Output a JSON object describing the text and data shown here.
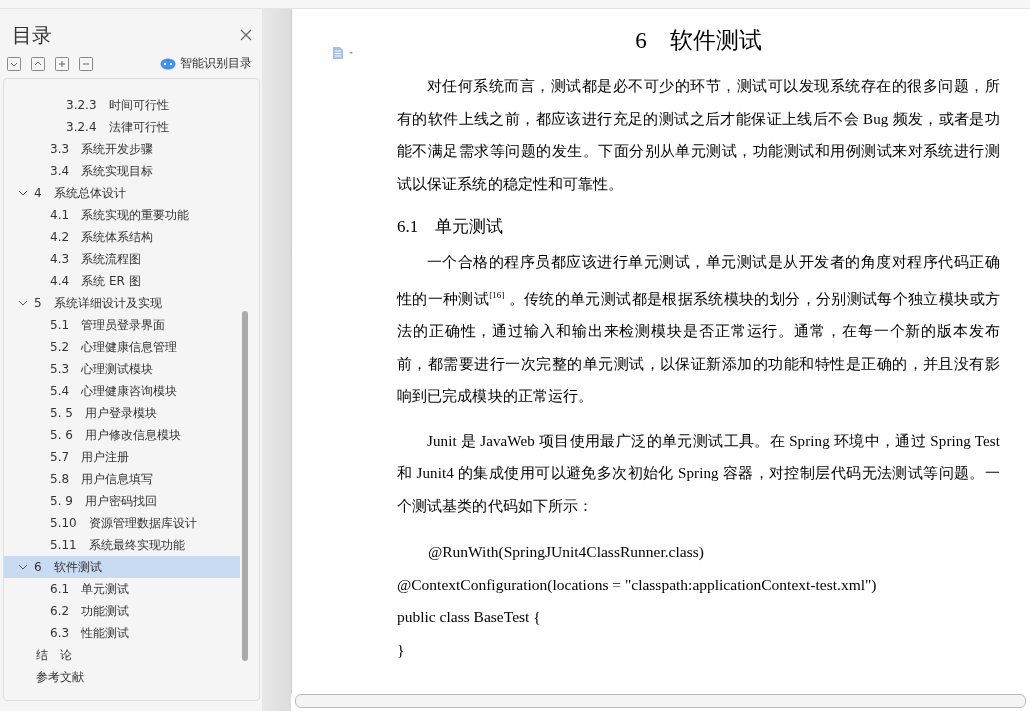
{
  "toc": {
    "title": "目录",
    "tools": [
      {
        "kind": "expand-all"
      },
      {
        "kind": "collapse-all"
      },
      {
        "kind": "plus"
      },
      {
        "kind": "minus"
      }
    ],
    "smart_button": "智能识别目录",
    "items": [
      {
        "children": [
          {
            "children": [
              {
                "number": "3.2.3",
                "title": "时间可行性",
                "selected": false
              },
              {
                "number": "3.2.4",
                "title": "法律可行性",
                "selected": false
              }
            ]
          },
          {
            "number": "3.3",
            "title": "系统开发步骤",
            "selected": false
          },
          {
            "number": "3.4",
            "title": "系统实现目标",
            "selected": false
          }
        ]
      },
      {
        "number": "4",
        "title": "系统总体设计",
        "selected": false,
        "expanded": true,
        "children": [
          {
            "number": "4.1",
            "title": "系统实现的重要功能",
            "selected": false
          },
          {
            "number": "4.2",
            "title": "系统体系结构",
            "selected": false
          },
          {
            "number": "4.3",
            "title": "系统流程图",
            "selected": false
          },
          {
            "number": "4.4",
            "title": "系统 ER 图",
            "selected": false
          }
        ]
      },
      {
        "number": "5",
        "title": "系统详细设计及实现",
        "selected": false,
        "expanded": true,
        "children": [
          {
            "number": "5.1",
            "title": "管理员登录界面",
            "selected": false
          },
          {
            "number": "5.2",
            "title": "心理健康信息管理",
            "selected": false
          },
          {
            "number": "5.3",
            "title": "心理测试模块",
            "selected": false
          },
          {
            "number": "5.4",
            "title": "心理健康咨询模块",
            "selected": false
          },
          {
            "number": "5. 5",
            "title": "用户登录模块",
            "selected": false
          },
          {
            "number": "5. 6",
            "title": "用户修改信息模块",
            "selected": false
          },
          {
            "number": "5.7",
            "title": "用户注册",
            "selected": false
          },
          {
            "number": "5.8",
            "title": "用户信息填写",
            "selected": false
          },
          {
            "number": "5. 9",
            "title": "用户密码找回",
            "selected": false
          },
          {
            "number": "5.10",
            "title": "资源管理数据库设计",
            "selected": false
          },
          {
            "number": "5.11",
            "title": "系统最终实现功能",
            "selected": false
          }
        ]
      },
      {
        "number": "6",
        "title": "软件测试",
        "selected": true,
        "expanded": true,
        "children": [
          {
            "number": "6.1",
            "title": "单元测试",
            "selected": false
          },
          {
            "number": "6.2",
            "title": "功能测试",
            "selected": false
          },
          {
            "number": "6.3",
            "title": "性能测试",
            "selected": false
          }
        ]
      },
      {
        "title": "结　论",
        "selected": false
      },
      {
        "title": "参考文献",
        "selected": false
      }
    ]
  },
  "document": {
    "blocks": [
      {
        "kind": "chapter",
        "number": "6",
        "title": "软件测试"
      },
      {
        "kind": "paragraph",
        "text": "对任何系统而言，测试都是必不可少的环节，测试可以发现系统存在的很多问题，所有的软件上线之前，都应该进行充足的测试之后才能保证上线后不会 Bug 频发，或者是功能不满足需求等问题的发生。下面分别从单元测试，功能测试和用例测试来对系统进行测试以保证系统的稳定性和可靠性。"
      },
      {
        "kind": "section",
        "number": "6.1",
        "title": "单元测试"
      },
      {
        "kind": "paragraph",
        "text": "一个合格的程序员都应该进行单元测试，单元测试是从开发者的角度对程序代码正确性的一种测试$^{[16]}$ 。传统的单元测试都是根据系统模块的划分，分别测试每个独立模块或方法的正确性，通过输入和输出来检测模块是否正常运行。通常，在每一个新的版本发布前，都需要进行一次完整的单元测试，以保证新添加的功能和特性是正确的，并且没有影响到已完成模块的正常运行。"
      },
      {
        "kind": "paragraph",
        "text": "Junit 是 JavaWeb 项目使用最广泛的单元测试工具。在 Spring 环境中，通过 Spring Test 和  Junit4 的集成使用可以避免多次初始化 Spring 容器，对控制层代码无法测试等问题。一个测试基类的代码如下所示："
      },
      {
        "kind": "code",
        "indent": true,
        "text": "@RunWith(SpringJUnit4ClassRunner.class)"
      },
      {
        "kind": "code",
        "indent": false,
        "text": "@ContextConfiguration(locations = \"classpath:applicationContext-test.xml\")"
      },
      {
        "kind": "code",
        "indent": false,
        "text": "public class BaseTest {"
      },
      {
        "kind": "code",
        "indent": false,
        "text": "}"
      }
    ]
  }
}
